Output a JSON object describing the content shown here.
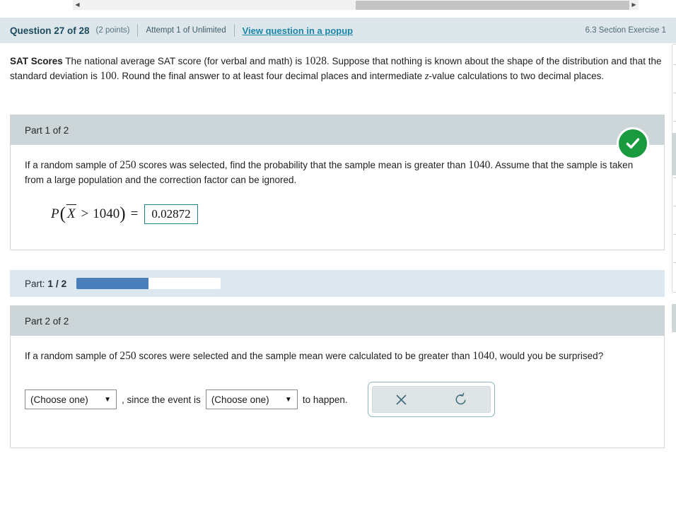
{
  "scrollbar": {
    "left_arrow": "◀",
    "right_arrow": "▶"
  },
  "header": {
    "question_number": "Question 27 of 28",
    "points": "(2 points)",
    "attempt": "Attempt 1 of Unlimited",
    "popup_link": "View question in a popup",
    "section_exercise": "6.3 Section Exercise 1",
    "background_color": "#dde6ea",
    "link_color": "#1b87a8"
  },
  "stem": {
    "title": "SAT Scores",
    "text_1": " The national average SAT score (for verbal and math) is ",
    "value_mean": "1028",
    "text_2": ". Suppose that nothing is known about the shape of the distribution and that the standard deviation is ",
    "value_sd": "100",
    "text_3": ". Round the final answer to at least four decimal places and intermediate ",
    "z_symbol": "z",
    "text_4": "-value calculations to two decimal places."
  },
  "part1": {
    "heading": "Part 1 of 2",
    "prompt": "If a random sample of 250 scores was selected, find the probability that the sample mean is greater than 1040. Assume that the sample is taken from a large population and the correction factor can be ignored.",
    "prompt_a": "If a random sample of ",
    "prompt_n": "250",
    "prompt_b": " scores was selected, find the probability that the sample mean is greater than ",
    "prompt_x": "1040",
    "prompt_c": ". Assume that the sample is taken from a large population and the correction factor can be ignored.",
    "formula": {
      "p": "P",
      "open_paren": "(",
      "xbar": "X",
      "operator": ">",
      "value": "1040",
      "close_paren": ")",
      "equals": "="
    },
    "answer_value": "0.02872",
    "status_icon": "check-circle-icon",
    "status_color": "#1a9a3f",
    "answer_border_color": "#247f8f"
  },
  "progress": {
    "label": "Part:",
    "current": "1",
    "separator": "/",
    "total": "2",
    "percent": 50,
    "fill_color": "#4a7ebb",
    "band_color": "#dde7f0"
  },
  "part2": {
    "heading": "Part 2 of 2",
    "prompt_a": "If a random sample of ",
    "prompt_n": "250",
    "prompt_b": " scores were selected and the sample mean were calculated to be greater than ",
    "prompt_x": "1040",
    "prompt_c": ", would you be surprised?",
    "dropdown_1": "(Choose one)",
    "dropdown_2": "(Choose one)",
    "caret": "▼",
    "sentence_mid": ", since the event is",
    "sentence_tail": "to happen.",
    "buttons": {
      "clear_label": "clear-x",
      "undo_label": "undo-refresh"
    }
  }
}
